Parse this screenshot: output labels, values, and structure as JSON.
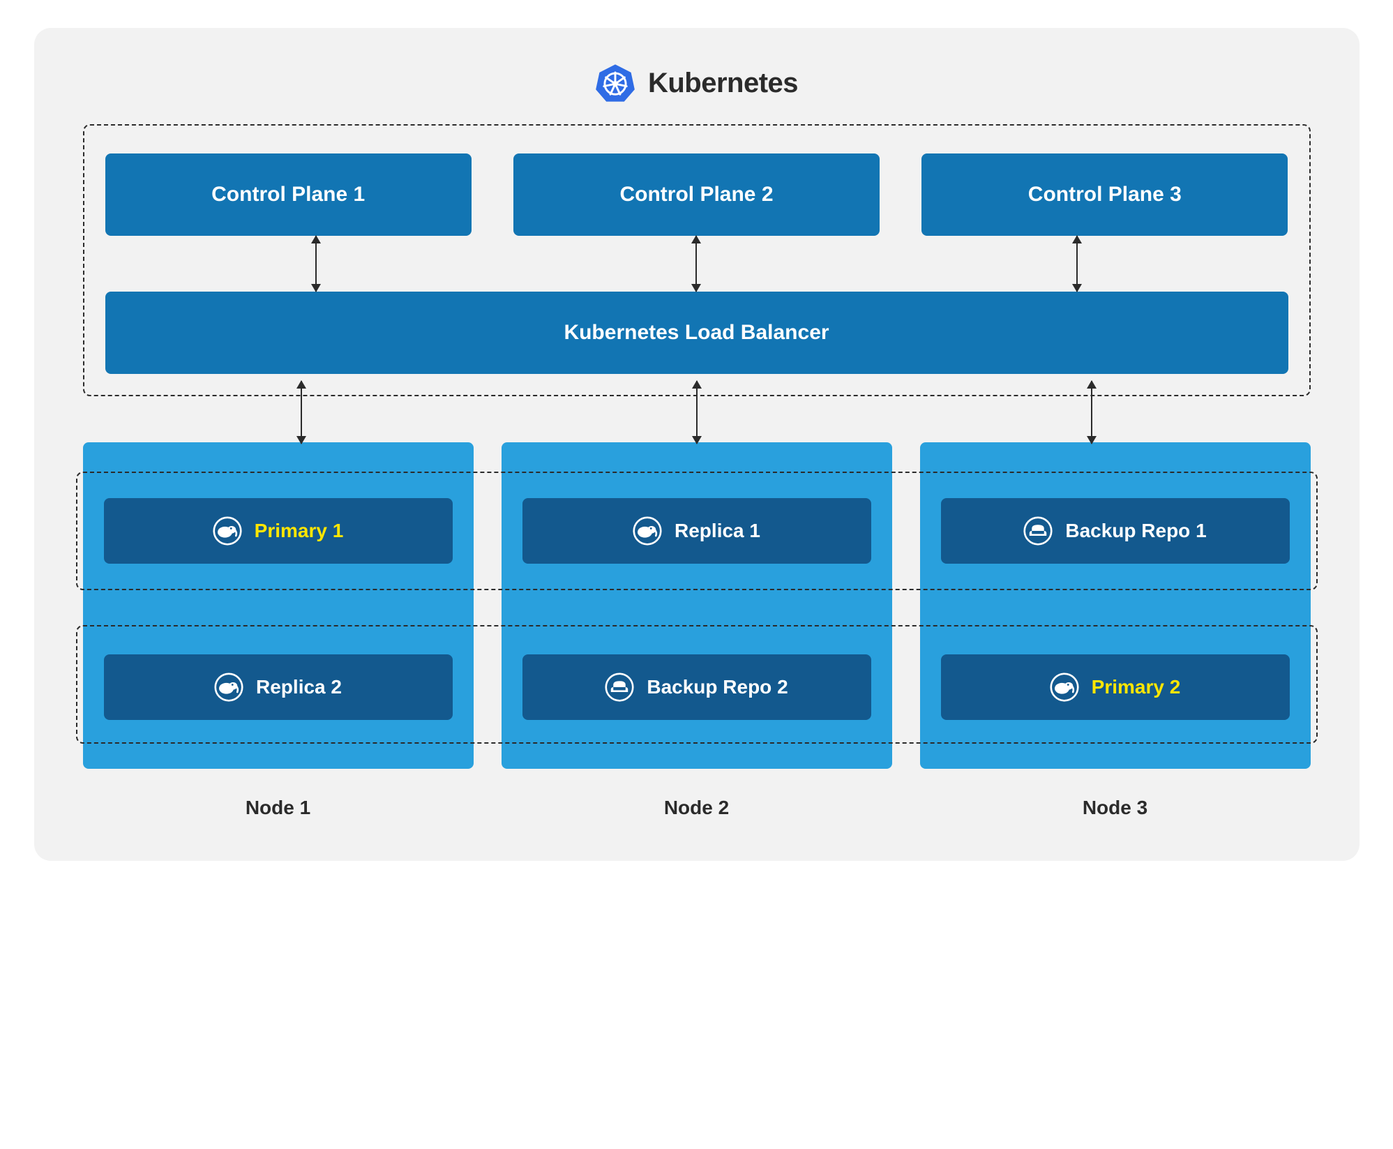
{
  "header": {
    "title": "Kubernetes"
  },
  "control_planes": [
    {
      "label": "Control Plane 1"
    },
    {
      "label": "Control Plane 2"
    },
    {
      "label": "Control Plane 3"
    }
  ],
  "load_balancer": {
    "label": "Kubernetes Load Balancer"
  },
  "nodes": [
    {
      "label": "Node 1",
      "pods": [
        {
          "label": "Primary 1",
          "icon": "elephant",
          "primary": true
        },
        {
          "label": "Replica 2",
          "icon": "elephant",
          "primary": false
        }
      ]
    },
    {
      "label": "Node 2",
      "pods": [
        {
          "label": "Replica 1",
          "icon": "elephant",
          "primary": false
        },
        {
          "label": "Backup Repo 2",
          "icon": "sofa",
          "primary": false
        }
      ]
    },
    {
      "label": "Node 3",
      "pods": [
        {
          "label": "Backup Repo 1",
          "icon": "sofa",
          "primary": false
        },
        {
          "label": "Primary 2",
          "icon": "elephant",
          "primary": true
        }
      ]
    }
  ],
  "colors": {
    "bg": "#f2f2f2",
    "box_dark": "#1275b3",
    "box_darker": "#13598e",
    "node_bg": "#29a0dd",
    "primary_text": "#ffe600",
    "dash": "#2b2b2b"
  }
}
